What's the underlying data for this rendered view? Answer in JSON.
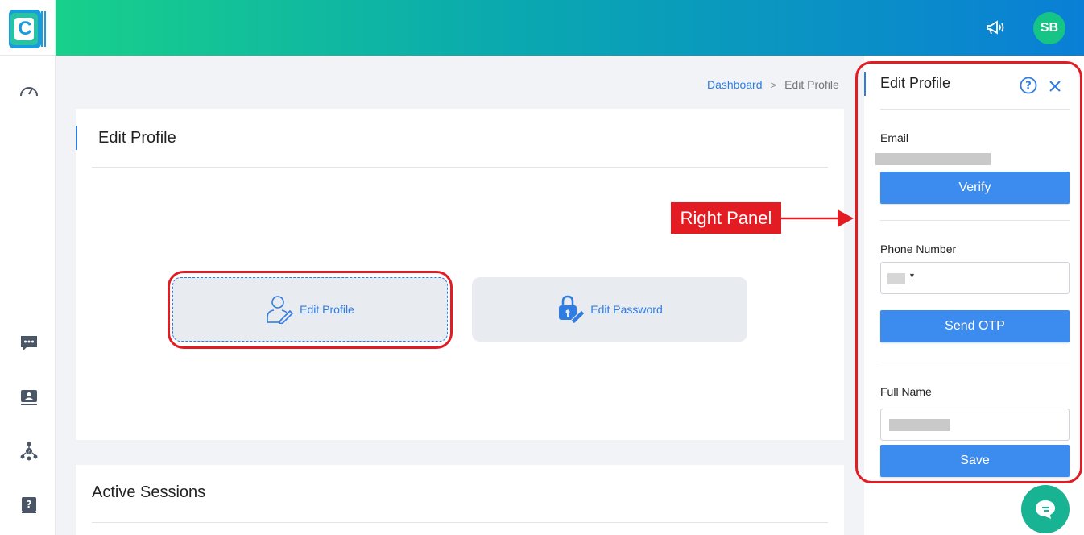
{
  "header": {
    "avatar_initials": "SB",
    "gradient_colors": [
      "#18d08a",
      "#0aa8b0",
      "#0a7fd6"
    ]
  },
  "sidebar": {
    "logo_letter": "C",
    "items": [
      {
        "icon": "speedometer-icon"
      },
      {
        "icon": "chat-icon"
      },
      {
        "icon": "id-card-icon"
      },
      {
        "icon": "org-chart-icon"
      },
      {
        "icon": "help-book-icon"
      }
    ]
  },
  "breadcrumb": {
    "root": "Dashboard",
    "separator": ">",
    "current": "Edit Profile"
  },
  "main": {
    "title": "Edit Profile",
    "tiles": [
      {
        "label": "Edit Profile",
        "icon": "user-edit-icon"
      },
      {
        "label": "Edit Password",
        "icon": "lock-edit-icon"
      }
    ]
  },
  "annotation": {
    "label": "Right Panel",
    "color": "#e31b23"
  },
  "sessions": {
    "title": "Active Sessions"
  },
  "panel": {
    "title": "Edit Profile",
    "email_label": "Email",
    "verify_label": "Verify",
    "phone_label": "Phone Number",
    "send_otp_label": "Send OTP",
    "fullname_label": "Full Name",
    "save_label": "Save",
    "button_color": "#3c8cf0"
  }
}
